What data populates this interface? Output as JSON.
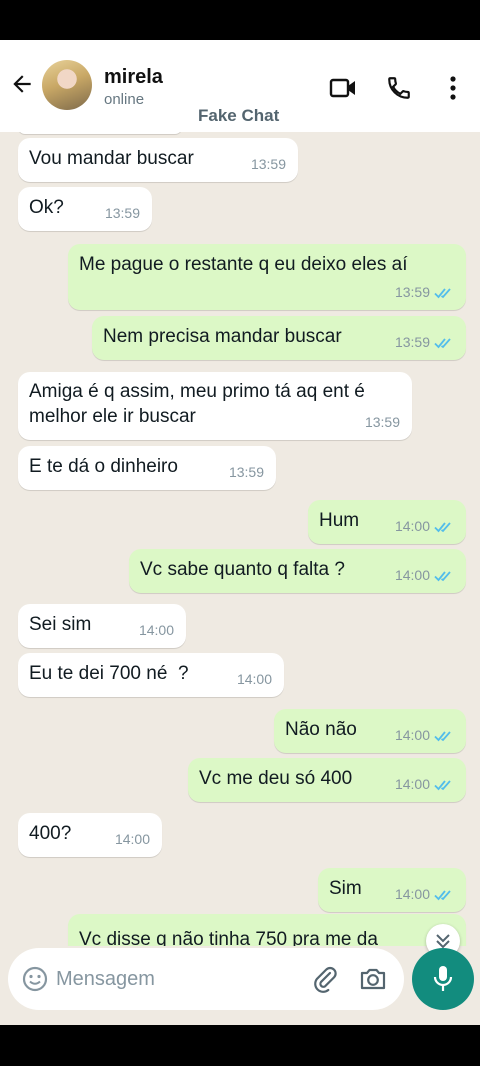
{
  "header": {
    "contact_name": "mirela",
    "contact_status": "online",
    "watermark": "Fake Chat",
    "icons": [
      "back-arrow-icon",
      "video-call-icon",
      "phone-icon",
      "more-vert-icon"
    ]
  },
  "messages": [
    {
      "dir": "in",
      "text": "Vou mandar buscar",
      "time": "13:59"
    },
    {
      "dir": "in",
      "text": "Ok?",
      "time": "13:59"
    },
    {
      "dir": "out",
      "text": "Me pague o restante q eu deixo eles aí",
      "time": "13:59",
      "read": true
    },
    {
      "dir": "out",
      "text": "Nem precisa mandar buscar",
      "time": "13:59",
      "read": true
    },
    {
      "dir": "in",
      "text": "Amiga é q assim, meu primo tá aq ent é\nmelhor ele ir buscar",
      "time": "13:59"
    },
    {
      "dir": "in",
      "text": "E te dá o dinheiro",
      "time": "13:59"
    },
    {
      "dir": "out",
      "text": "Hum",
      "time": "14:00",
      "read": true
    },
    {
      "dir": "out",
      "text": "Vc sabe quanto q falta ?",
      "time": "14:00",
      "read": true
    },
    {
      "dir": "in",
      "text": "Sei sim",
      "time": "14:00"
    },
    {
      "dir": "in",
      "text": "Eu te dei 700 né  ?",
      "time": "14:00"
    },
    {
      "dir": "out",
      "text": "Não não",
      "time": "14:00",
      "read": true
    },
    {
      "dir": "out",
      "text": "Vc me deu só 400",
      "time": "14:00",
      "read": true
    },
    {
      "dir": "in",
      "text": "400?",
      "time": "14:00"
    },
    {
      "dir": "out",
      "text": "Sim",
      "time": "14:00",
      "read": true
    },
    {
      "dir": "out",
      "text": "Vc disse q não tinha 750 pra me da",
      "time": "",
      "read": false
    }
  ],
  "composer": {
    "placeholder": "Mensagem",
    "icons": [
      "emoji-icon",
      "attach-icon",
      "camera-icon",
      "mic-icon"
    ]
  },
  "colors": {
    "incoming_bubble": "#ffffff",
    "outgoing_bubble": "#dcf8c6",
    "chat_background": "#efeae2",
    "read_ticks": "#53bdeb",
    "mic_button": "#128c7e"
  }
}
